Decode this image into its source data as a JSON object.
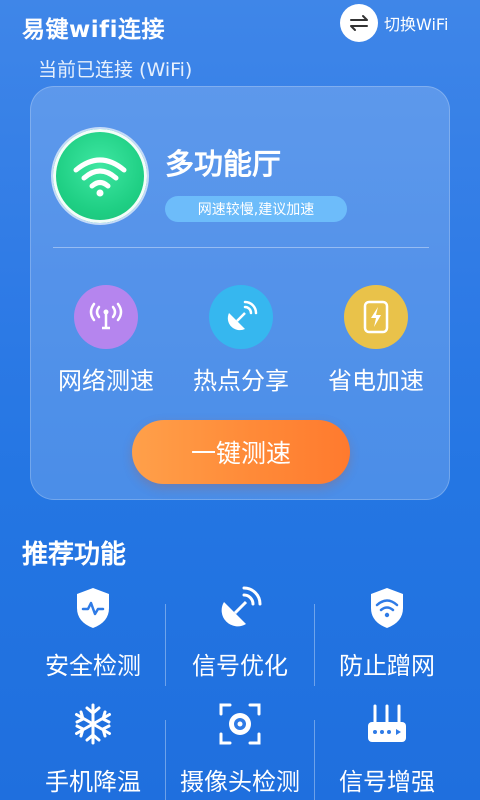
{
  "header": {
    "app_title": "易键wifi连接",
    "switch_label": "切换WiFi"
  },
  "connection": {
    "label": "当前已连接 (WiFi)",
    "network_name": "多功能厅",
    "speed_status": "网速较慢,建议加速"
  },
  "features": [
    {
      "label": "网络测速",
      "icon": "signal-waves-icon",
      "color": "#b585ee"
    },
    {
      "label": "热点分享",
      "icon": "satellite-dish-icon",
      "color": "#36b7ef"
    },
    {
      "label": "省电加速",
      "icon": "battery-charge-icon",
      "color": "#e9c24a"
    }
  ],
  "speed_test_button": "一键测速",
  "recommended": {
    "title": "推荐功能",
    "items": [
      {
        "label": "安全检测",
        "icon": "shield-pulse-icon"
      },
      {
        "label": "信号优化",
        "icon": "satellite-dish-icon"
      },
      {
        "label": "防止蹭网",
        "icon": "wifi-shield-icon"
      },
      {
        "label": "手机降温",
        "icon": "snowflake-icon"
      },
      {
        "label": "摄像头检测",
        "icon": "camera-scan-icon"
      },
      {
        "label": "信号增强",
        "icon": "router-icon"
      }
    ]
  },
  "colors": {
    "wifi_green": "#1fcf84",
    "button_orange": "#ff8a38",
    "badge_blue": "#6dbcfa"
  }
}
